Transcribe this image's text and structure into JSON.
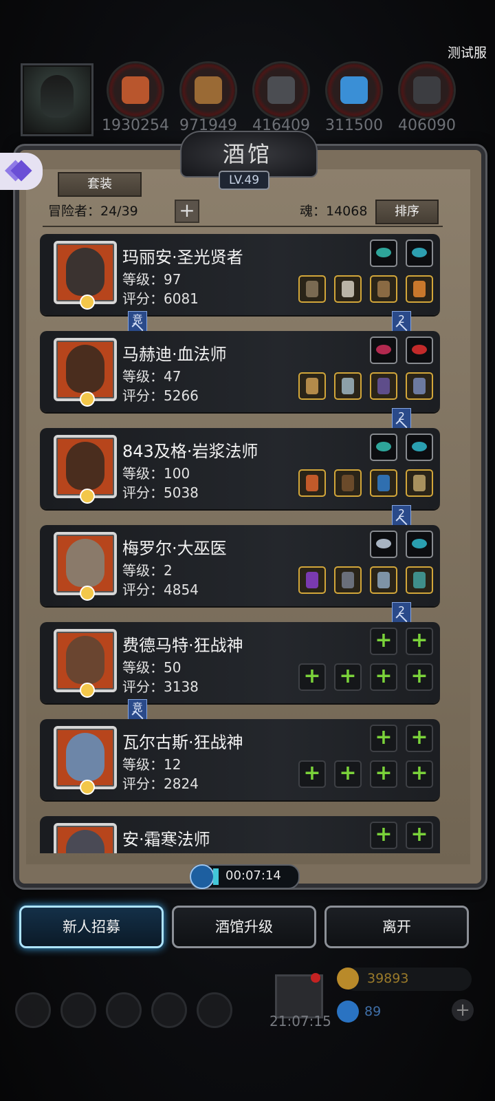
{
  "server_tag": "测试服",
  "resources": [
    {
      "value": "1930254",
      "icon": "meat-icon",
      "color": "#b9562d"
    },
    {
      "value": "971949",
      "icon": "wood-icon",
      "color": "#9a6a35"
    },
    {
      "value": "416409",
      "icon": "iron-icon",
      "color": "#4b4d52"
    },
    {
      "value": "311500",
      "icon": "crystal-icon",
      "color": "#3a8fd6"
    },
    {
      "value": "406090",
      "icon": "stone-icon",
      "color": "#3c3d41"
    }
  ],
  "panel": {
    "title": "酒馆",
    "level": "LV.49",
    "set_button": "套装",
    "adventurer_label": "冒险者：24/39",
    "soul_label": "魂：14068",
    "sort_button": "排序",
    "plus_symbol": "+"
  },
  "heroes": [
    {
      "name": "玛丽安·圣光贤者",
      "level": "等级：97",
      "score": "评分：6081",
      "portrait": "dark-haired-sage-portrait",
      "face_color": "#3b3330",
      "jewels": [
        "#2ea59a",
        "#2d9fb0"
      ],
      "equips": [
        "#7a6a52",
        "#b9b3a6",
        "#8a6a43",
        "#c9782c"
      ],
      "badge_left": "竞",
      "badge_right": "2"
    },
    {
      "name": "马赫迪·血法师",
      "level": "等级：47",
      "score": "评分：5266",
      "portrait": "bald-mage-portrait",
      "face_color": "#4a2d1e",
      "jewels": [
        "#b2294f",
        "#c22a2a"
      ],
      "equips": [
        "#b38a4a",
        "#8da0a8",
        "#5e4d8a",
        "#6c7aa0"
      ],
      "badge_left": "",
      "badge_right": "2"
    },
    {
      "name": "843及格·岩浆法师",
      "level": "等级：100",
      "score": "评分：5038",
      "portrait": "bald-mage-portrait",
      "face_color": "#4a2d1e",
      "jewels": [
        "#2ea59a",
        "#2a9fb0"
      ],
      "equips": [
        "#c25a2a",
        "#6a4a2a",
        "#2f6fb0",
        "#a8915e"
      ],
      "badge_left": "",
      "badge_right": "2"
    },
    {
      "name": "梅罗尔·大巫医",
      "level": "等级：2",
      "score": "评分：4854",
      "portrait": "old-shaman-portrait",
      "face_color": "#8a7a6a",
      "jewels": [
        "#a7b3c2",
        "#2a9fb0"
      ],
      "equips": [
        "#7a3ab0",
        "#6a6f7a",
        "#7e93a6",
        "#3f8f8a"
      ],
      "badge_left": "",
      "badge_right": "2"
    },
    {
      "name": "费德马特·狂战神",
      "level": "等级：50",
      "score": "评分：3138",
      "portrait": "brawler-portrait",
      "face_color": "#6a4530",
      "jewels": [],
      "equips": [],
      "badge_left": "竞",
      "badge_right": ""
    },
    {
      "name": "瓦尔古斯·狂战神",
      "level": "等级：12",
      "score": "评分：2824",
      "portrait": "stone-warrior-portrait",
      "face_color": "#6d86a8",
      "jewels": [],
      "equips": [],
      "badge_left": "",
      "badge_right": ""
    },
    {
      "name": "安·霜寒法师",
      "level": "",
      "score": "",
      "portrait": "hooded-mage-portrait",
      "face_color": "#4a4a55",
      "jewels": [],
      "equips": [],
      "badge_left": "",
      "badge_right": ""
    }
  ],
  "timer": "00:07:14",
  "buttons": {
    "recruit": "新人招募",
    "upgrade": "酒馆升级",
    "leave": "离开"
  },
  "bottom": {
    "time": "21:07:15",
    "gold": "39893",
    "gems": "89"
  }
}
